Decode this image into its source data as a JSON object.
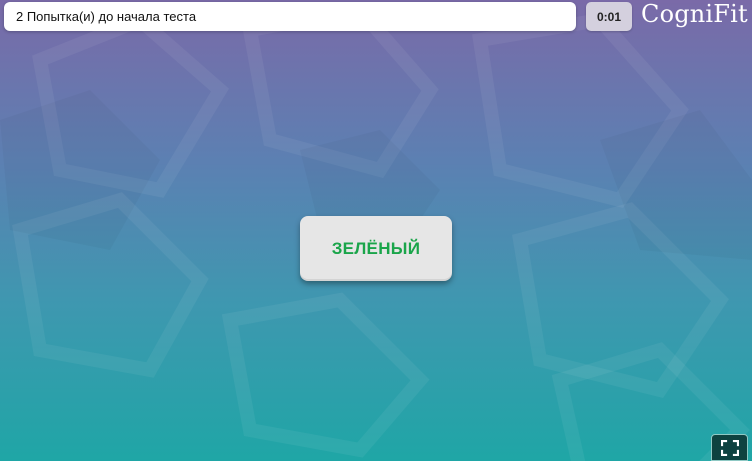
{
  "status": {
    "attempts_text": "2 Попытка(и) до начала теста"
  },
  "timer": {
    "value": "0:01"
  },
  "logo": {
    "text": "CogniFit"
  },
  "stimulus": {
    "word": "ЗЕЛЁНЫЙ",
    "ink_color": "#1aa54a"
  },
  "fullscreen": {
    "icon": "fullscreen-icon"
  },
  "colors": {
    "background_top": "#7a6aa8",
    "background_bottom": "#1fa6a6",
    "timer_bg": "#d4d0de",
    "fullscreen_bg": "#0e4240"
  }
}
